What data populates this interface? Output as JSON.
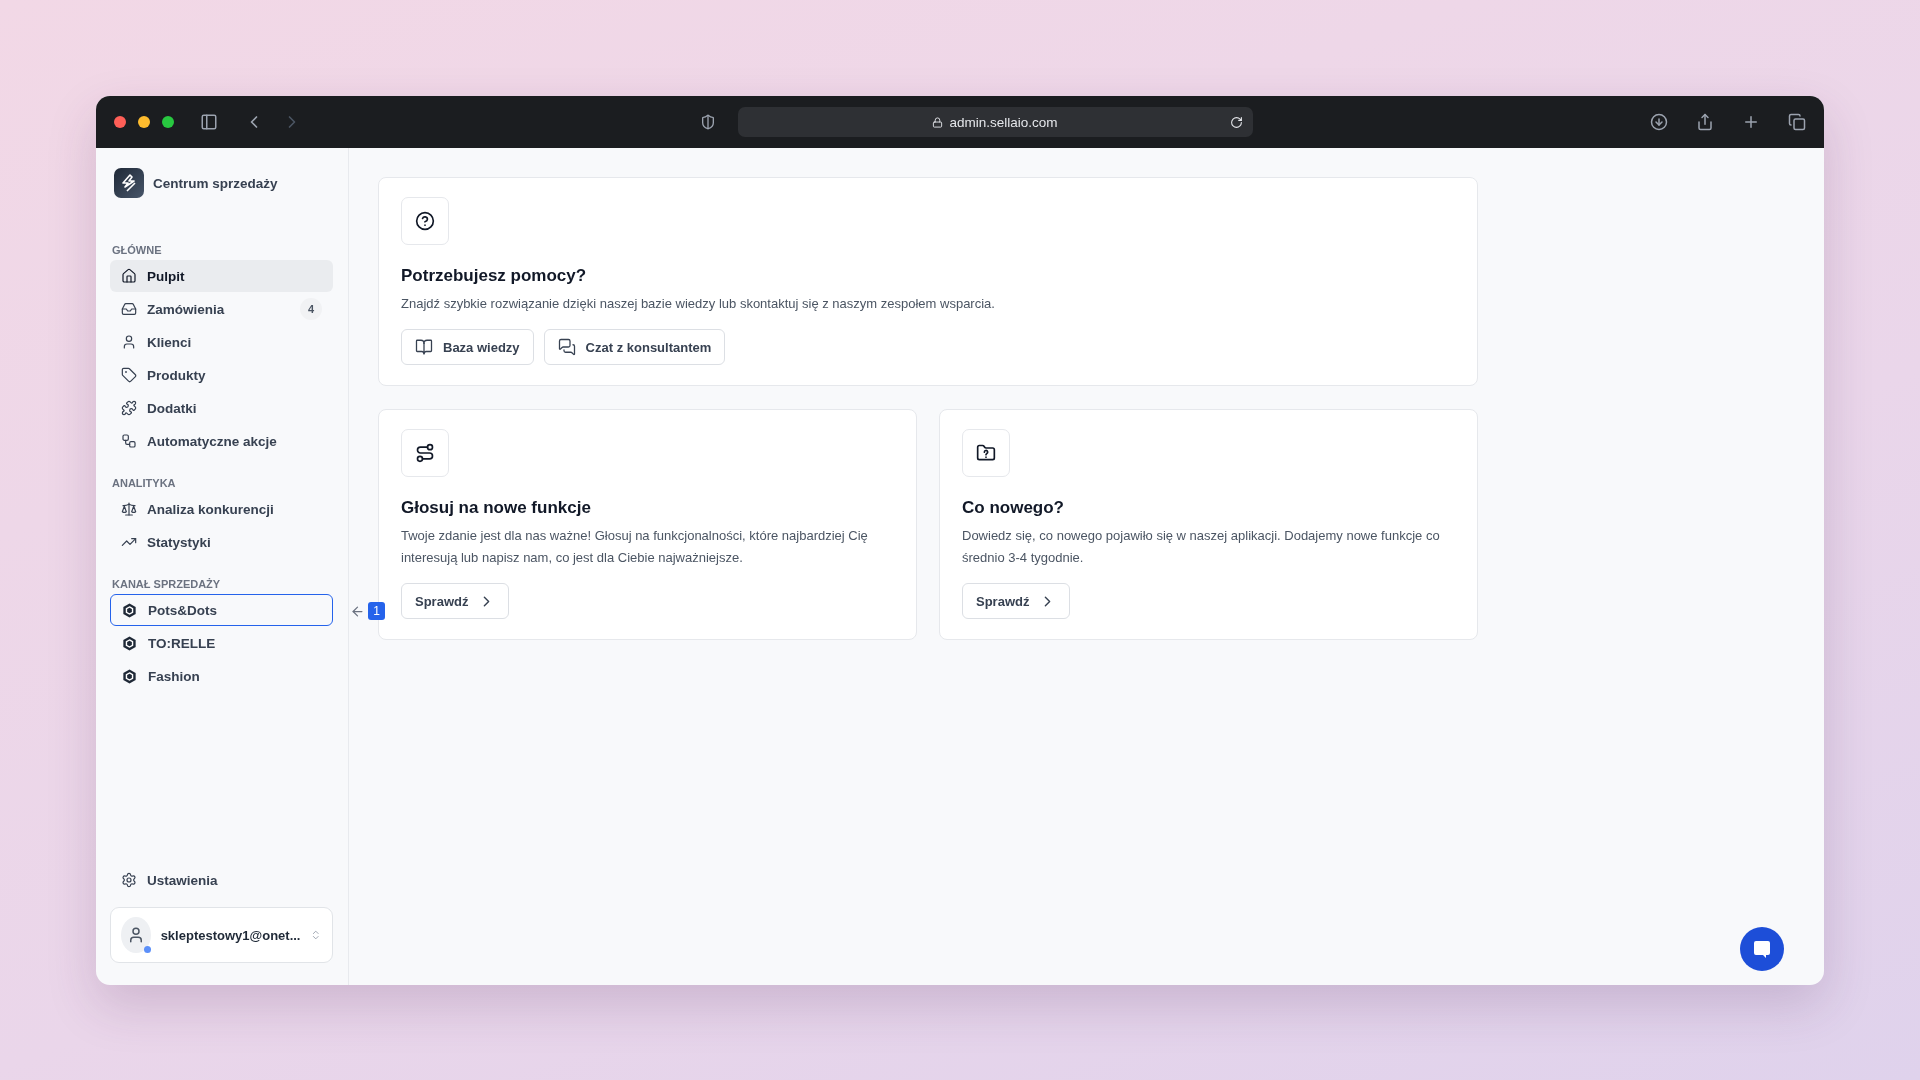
{
  "browser": {
    "url": "admin.sellaio.com"
  },
  "sidebar": {
    "brand": "Centrum sprzedaży",
    "sections": [
      {
        "heading": "GŁÓWNE",
        "items": [
          {
            "label": "Pulpit",
            "selected": true,
            "focused": false
          },
          {
            "label": "Zamówienia",
            "badge": "4",
            "selected": false,
            "focused": false
          },
          {
            "label": "Klienci",
            "selected": false,
            "focused": false
          },
          {
            "label": "Produkty",
            "selected": false,
            "focused": false
          },
          {
            "label": "Dodatki",
            "selected": false,
            "focused": false
          },
          {
            "label": "Automatyczne akcje",
            "selected": false,
            "focused": false
          }
        ]
      },
      {
        "heading": "ANALITYKA",
        "items": [
          {
            "label": "Analiza konkurencji",
            "selected": false,
            "focused": false
          },
          {
            "label": "Statystyki",
            "selected": false,
            "focused": false
          }
        ]
      },
      {
        "heading": "KANAŁ SPRZEDAŻY",
        "items": [
          {
            "label": "Pots&Dots",
            "selected": false,
            "focused": true,
            "annotation": "1"
          },
          {
            "label": "TO:RELLE",
            "selected": false,
            "focused": false
          },
          {
            "label": "Fashion",
            "selected": false,
            "focused": false
          }
        ]
      }
    ],
    "settings": "Ustawienia",
    "account": {
      "email": "skleptestowy1@onet...",
      "online": true
    }
  },
  "cards": [
    {
      "title": "Potrzebujesz pomocy?",
      "text": "Znajdź szybkie rozwiązanie dzięki naszej bazie wiedzy lub skontaktuj się z naszym zespołem wsparcia.",
      "buttons": [
        "Baza wiedzy",
        "Czat z konsultantem"
      ]
    },
    {
      "title": "Głosuj na nowe funkcje",
      "text": "Twoje zdanie jest dla nas ważne! Głosuj na funkcjonalności, które najbardziej Cię interesują lub napisz nam, co jest dla Ciebie najważniejsze.",
      "buttons": [
        "Sprawdź"
      ]
    },
    {
      "title": "Co nowego?",
      "text": "Dowiedz się, co nowego pojawiło się w naszej aplikacji. Dodajemy nowe funkcje co średnio 3-4 tygodnie.",
      "buttons": [
        "Sprawdź"
      ]
    }
  ]
}
